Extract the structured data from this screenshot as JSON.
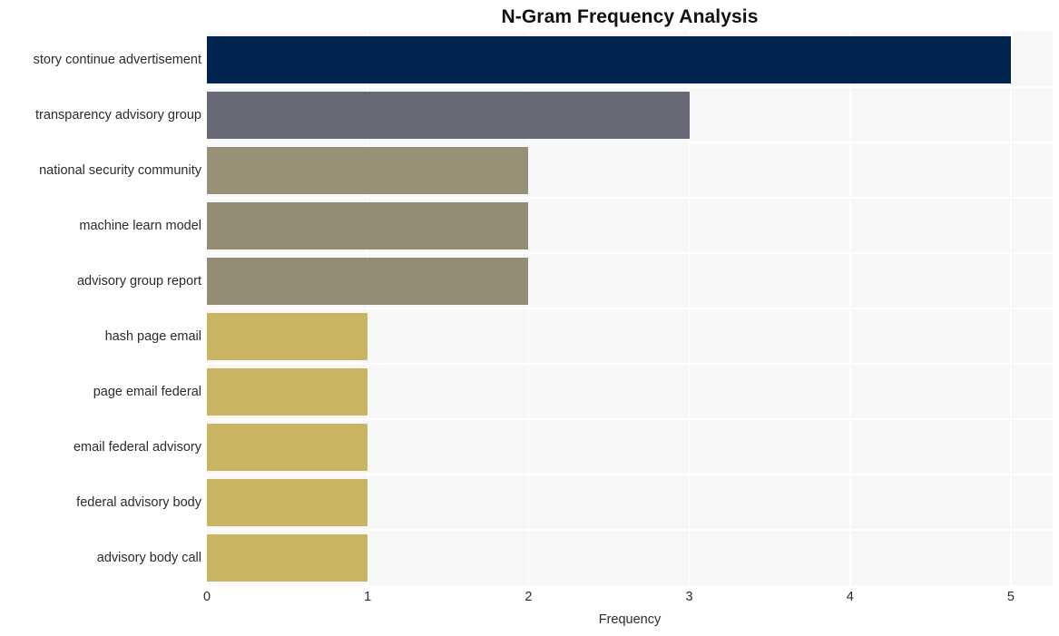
{
  "chart_data": {
    "type": "bar",
    "orientation": "horizontal",
    "title": "N-Gram Frequency Analysis",
    "xlabel": "Frequency",
    "ylabel": "",
    "xlim": [
      0,
      5.26
    ],
    "xticks": [
      "0",
      "1",
      "2",
      "3",
      "4",
      "5"
    ],
    "xtick_values": [
      0,
      1,
      2,
      3,
      4,
      5
    ],
    "grid": true,
    "grid_color": "#ffffff",
    "plot_background": "#f7f7f8",
    "legend": null,
    "categories": [
      "story continue advertisement",
      "transparency advisory group",
      "national security community",
      "machine learn model",
      "advisory group report",
      "hash page email",
      "page email federal",
      "email federal advisory",
      "federal advisory body",
      "advisory body call"
    ],
    "values": [
      5,
      3,
      2,
      2,
      2,
      1,
      1,
      1,
      1,
      1
    ],
    "bar_colors": [
      "#00244e",
      "#676a76",
      "#978f76",
      "#928c74",
      "#928c74",
      "#c9b461",
      "#c9b461",
      "#c9b461",
      "#c9b461",
      "#c9b461"
    ]
  }
}
